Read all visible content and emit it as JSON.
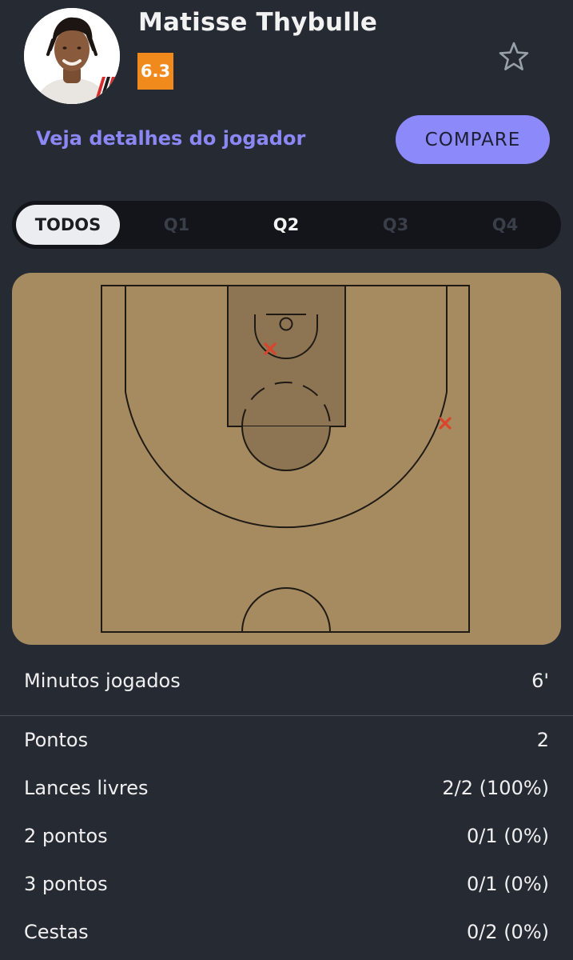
{
  "player": {
    "name": "Matisse Thybulle",
    "rating": "6.3",
    "rating_color": "#f08a1c"
  },
  "actions": {
    "details_link": "Veja detalhes do jogador",
    "compare_button": "COMPARE"
  },
  "periods": [
    {
      "label": "TODOS",
      "state": "active"
    },
    {
      "label": "Q1",
      "state": "disabled"
    },
    {
      "label": "Q2",
      "state": "enabled"
    },
    {
      "label": "Q3",
      "state": "disabled"
    },
    {
      "label": "Q4",
      "state": "disabled"
    }
  ],
  "shot_chart": {
    "court_color": "#a68b60",
    "paint_color": "#8d7553",
    "miss_color": "#d9442b",
    "shots": [
      {
        "result": "miss",
        "zone": "paint"
      },
      {
        "result": "miss",
        "zone": "right-wing"
      }
    ]
  },
  "stats": {
    "minutes": {
      "label": "Minutos jogados",
      "value": "6'"
    },
    "points": {
      "label": "Pontos",
      "value": "2"
    },
    "free_throws": {
      "label": "Lances livres",
      "value": "2/2 (100%)"
    },
    "two_pointers": {
      "label": "2 pontos",
      "value": "0/1 (0%)"
    },
    "three_pointers": {
      "label": "3 pontos",
      "value": "0/1 (0%)"
    },
    "field_goals": {
      "label": "Cestas",
      "value": "0/2 (0%)"
    }
  },
  "icons": {
    "favorite": "star-outline-icon",
    "team_logo": "blazers-logo-icon"
  }
}
